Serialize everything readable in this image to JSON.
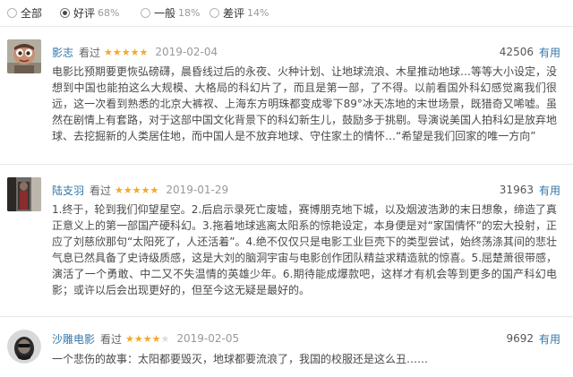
{
  "filters": [
    {
      "label": "全部",
      "pct": "",
      "checked": false
    },
    {
      "label": "好评",
      "pct": "68%",
      "checked": true
    },
    {
      "label": "一般",
      "pct": "18%",
      "checked": false
    },
    {
      "label": "差评",
      "pct": "14%",
      "checked": false
    }
  ],
  "reviews": [
    {
      "author": "影志",
      "status": "看过",
      "rating": 5,
      "date": "2019-02-04",
      "votes": "42506",
      "useful_label": "有用",
      "text": "电影比预期要更恢弘磅礴，晨昏线过后的永夜、火种计划、让地球流浪、木星推动地球…等等大小设定，没想到中国也能拍这么大规模、大格局的科幻片了，而且是第一部，了不得。以前看国外科幻感觉离我们很远，这一次看到熟悉的北京大裤衩、上海东方明珠都变成零下89°冰天冻地的末世场景，既猎奇又唏嘘。虽然在剧情上有套路，对于这部中国文化背景下的科幻新生儿，鼓励多于挑剔。导演说美国人拍科幻是放弃地球、去挖掘新的人类居住地，而中国人是不放弃地球、守住家土的情怀…“希望是我们回家的唯一方向”"
    },
    {
      "author": "陆支羽",
      "status": "看过",
      "rating": 5,
      "date": "2019-01-29",
      "votes": "31963",
      "useful_label": "有用",
      "text": "1.终于，轮到我们仰望星空。2.后启示录死亡废墟，赛博朋克地下城，以及烟波浩渺的末日想象，缔造了真正意义上的第一部国产硬科幻。3.拖着地球逃离太阳系的惊艳设定，本身便是对“家国情怀”的宏大投射，正应了刘慈欣那句“太阳死了，人还活着”。4.绝不仅仅只是电影工业巨壳下的类型尝试，始终荡涤其间的悲壮气息已然具备了史诗级质感，这是大刘的脑洞宇宙与电影创作团队精益求精造就的惊喜。5.屈楚萧很带感，演活了一个勇敢、中二又不失温情的英雄少年。6.期待能成爆款吧，这样才有机会等到更多的国产科幻电影；或许以后会出现更好的，但至今这无疑是最好的。"
    },
    {
      "author": "沙雕电影",
      "status": "看过",
      "rating": 4,
      "date": "2019-02-05",
      "votes": "9692",
      "useful_label": "有用",
      "text": "一个悲伤的故事：太阳都要毁灭，地球都要流浪了，我国的校服还是这么丑……"
    }
  ],
  "colors": {
    "author_link": "#3377aa",
    "star_on": "#f4a82a",
    "star_off": "#dcdcdc"
  }
}
